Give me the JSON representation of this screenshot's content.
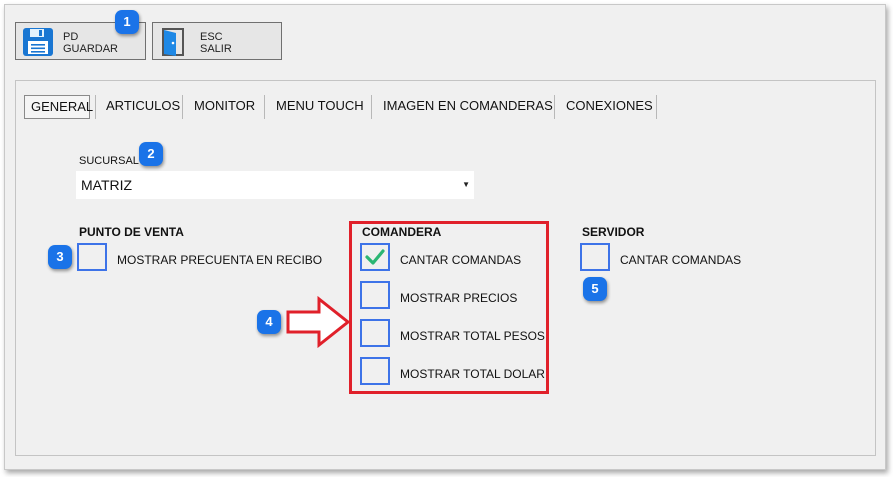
{
  "toolbar": {
    "save": {
      "key": "PD",
      "label": "GUARDAR"
    },
    "exit": {
      "key": "ESC",
      "label": "SALIR"
    }
  },
  "tabs": [
    {
      "label": "GENERAL",
      "active": true
    },
    {
      "label": "ARTICULOS"
    },
    {
      "label": "MONITOR"
    },
    {
      "label": "MENU TOUCH"
    },
    {
      "label": "IMAGEN EN COMANDERAS"
    },
    {
      "label": "CONEXIONES"
    }
  ],
  "sucursal": {
    "label": "SUCURSAL",
    "value": "MATRIZ"
  },
  "punto_de_venta": {
    "heading": "PUNTO DE VENTA",
    "options": [
      {
        "label": "MOSTRAR PRECUENTA EN RECIBO",
        "checked": false
      }
    ]
  },
  "comandera": {
    "heading": "COMANDERA",
    "options": [
      {
        "label": "CANTAR COMANDAS",
        "checked": true
      },
      {
        "label": "MOSTRAR PRECIOS",
        "checked": false
      },
      {
        "label": "MOSTRAR TOTAL PESOS",
        "checked": false
      },
      {
        "label": "MOSTRAR TOTAL DOLAR",
        "checked": false
      }
    ]
  },
  "servidor": {
    "heading": "SERVIDOR",
    "options": [
      {
        "label": "CANTAR COMANDAS",
        "checked": false
      }
    ]
  },
  "badges": [
    "1",
    "2",
    "3",
    "4",
    "5"
  ],
  "colors": {
    "badge": "#1a73e8",
    "highlight": "#e0202a",
    "checkbox_border": "#3d73e8",
    "check": "#2bb673"
  }
}
